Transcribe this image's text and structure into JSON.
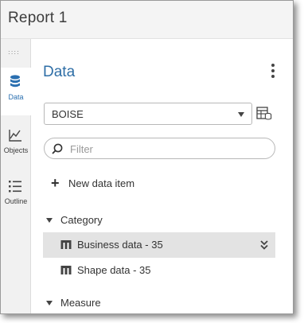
{
  "window": {
    "title": "Report 1"
  },
  "rail": {
    "tabs": [
      {
        "label": "Data",
        "icon": "database-icon",
        "active": true
      },
      {
        "label": "Objects",
        "icon": "line-chart-icon",
        "active": false
      },
      {
        "label": "Outline",
        "icon": "list-icon",
        "active": false
      }
    ]
  },
  "panel": {
    "title": "Data",
    "data_source": {
      "value": "BOISE"
    },
    "filter": {
      "placeholder": "Filter"
    },
    "new_item_label": "New data item",
    "groups": [
      {
        "label": "Category",
        "items": [
          {
            "label": "Business data - 35",
            "selected": true
          },
          {
            "label": "Shape data - 35",
            "selected": false
          }
        ]
      },
      {
        "label": "Measure",
        "items": []
      }
    ]
  },
  "colors": {
    "accent": "#2e6ea6",
    "selected_row": "#e3e3e3",
    "rail_bg": "#f1f1f1",
    "titlebar_bg": "#f4f4f4"
  }
}
